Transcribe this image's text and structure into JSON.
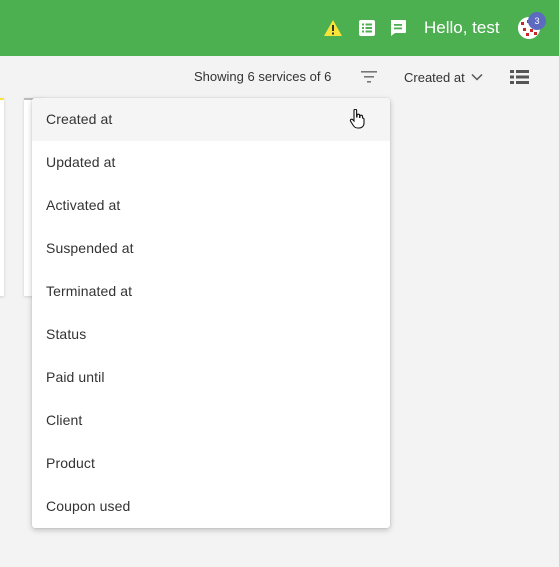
{
  "header": {
    "greeting": "Hello, test",
    "badge_count": "3",
    "icons": [
      "warning-icon",
      "list-icon",
      "message-icon"
    ],
    "colors": {
      "bar": "#4caf50",
      "warning": "#f7e436",
      "badge": "#5c6bc0"
    }
  },
  "toolbar": {
    "showing_text": "Showing 6 services of 6",
    "sort_label": "Created at"
  },
  "sort_menu": {
    "items": [
      "Created at",
      "Updated at",
      "Activated at",
      "Suspended at",
      "Terminated at",
      "Status",
      "Paid until",
      "Client",
      "Product",
      "Coupon used"
    ],
    "active_index": 0
  }
}
